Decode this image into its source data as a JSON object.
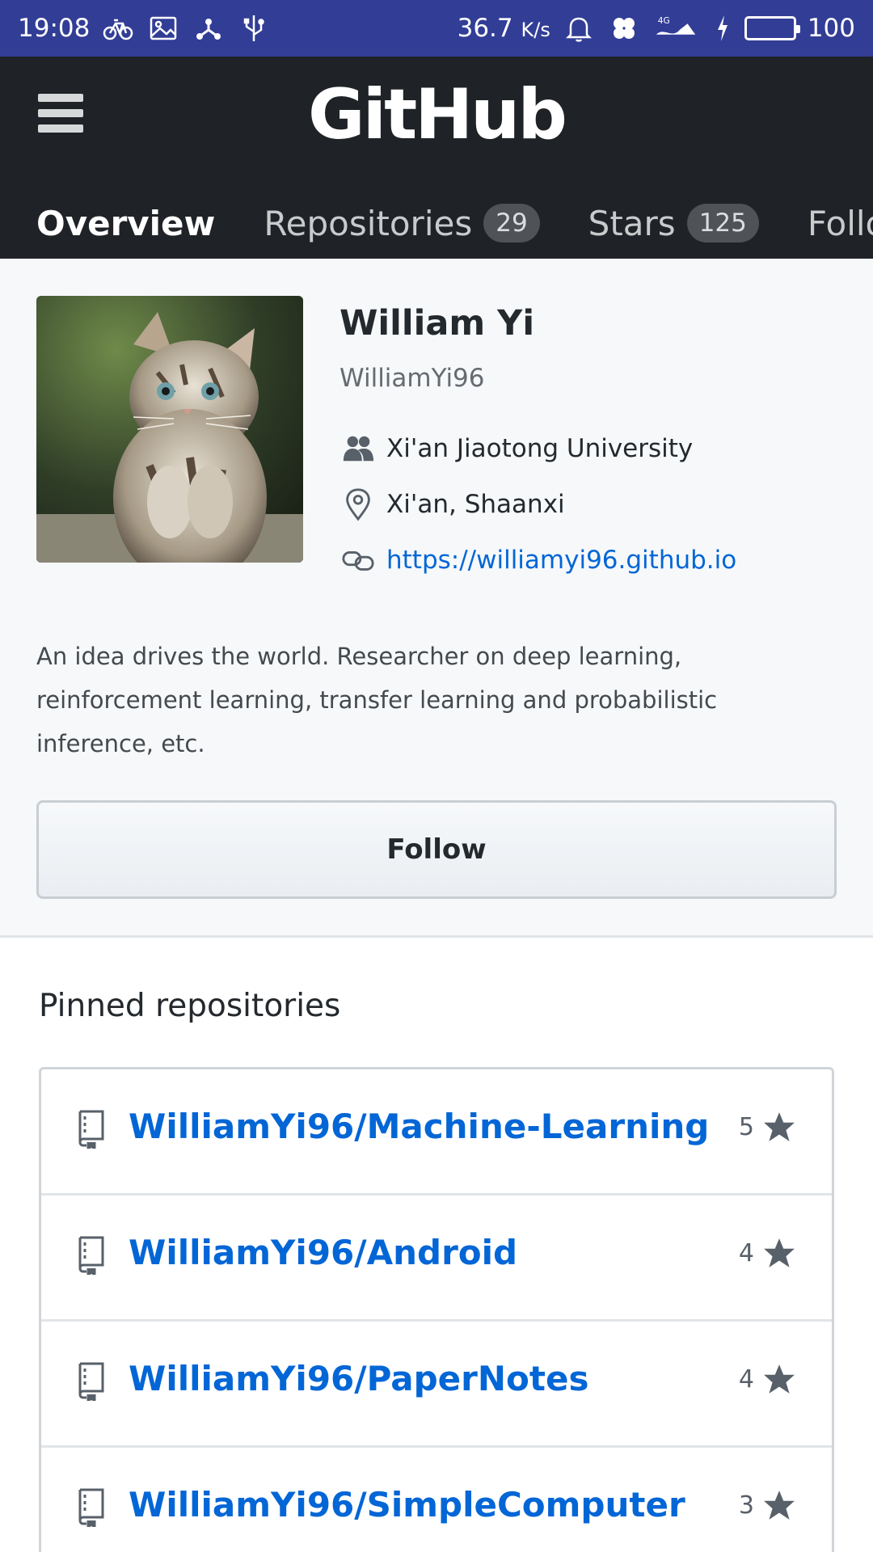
{
  "status_bar": {
    "time": "19:08",
    "speed": "36.7",
    "speed_unit": "K/s",
    "network": "4G",
    "battery": "100",
    "icons_left": [
      "bicycle-icon",
      "image-icon",
      "share-icon",
      "usb-icon"
    ],
    "icons_right": [
      "bell-icon",
      "clover-icon",
      "signal-icon",
      "charging-icon",
      "battery-icon"
    ]
  },
  "header": {
    "brand": "GitHub",
    "tabs": [
      {
        "label": "Overview",
        "count": ""
      },
      {
        "label": "Repositories",
        "count": "29"
      },
      {
        "label": "Stars",
        "count": "125"
      },
      {
        "label": "Followers",
        "count": ""
      }
    ]
  },
  "profile": {
    "full_name": "William Yi",
    "login": "WilliamYi96",
    "organization": "Xi'an Jiaotong University",
    "location": "Xi'an, Shaanxi",
    "website": "https://williamyi96.github.io",
    "bio": "An idea drives the world. Researcher on deep learning, reinforcement learning, transfer learning and probabilistic inference, etc.",
    "follow_label": "Follow"
  },
  "pinned": {
    "title": "Pinned repositories",
    "repos": [
      {
        "name": "WilliamYi96/Machine-Learning",
        "stars": "5"
      },
      {
        "name": "WilliamYi96/Android",
        "stars": "4"
      },
      {
        "name": "WilliamYi96/PaperNotes",
        "stars": "4"
      },
      {
        "name": "WilliamYi96/SimpleComputer",
        "stars": "3"
      }
    ]
  },
  "colors": {
    "status_bar": "#323d96",
    "header": "#1f2327",
    "link": "#0366d6",
    "profile_bg": "#f6f8fa"
  }
}
